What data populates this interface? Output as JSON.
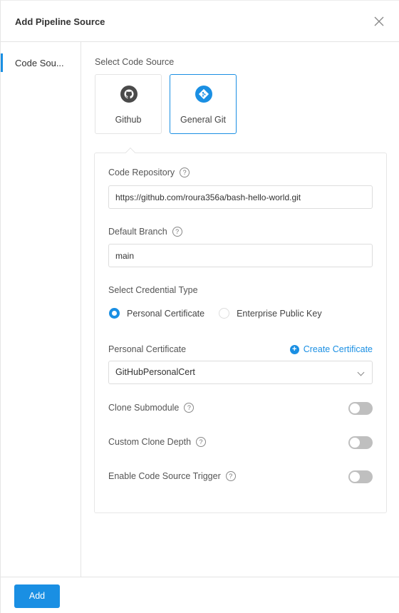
{
  "dialog": {
    "title": "Add Pipeline Source",
    "close_icon": "close-icon"
  },
  "sidebar": {
    "items": [
      {
        "label": "Code Sou...",
        "active": true
      }
    ]
  },
  "code_source": {
    "label": "Select Code Source",
    "options": [
      {
        "label": "Github",
        "icon": "github-icon",
        "selected": false
      },
      {
        "label": "General Git",
        "icon": "git-icon",
        "selected": true
      }
    ]
  },
  "form": {
    "code_repository": {
      "label": "Code Repository",
      "value": "https://github.com/roura356a/bash-hello-world.git"
    },
    "default_branch": {
      "label": "Default Branch",
      "value": "main"
    },
    "credential_type": {
      "label": "Select Credential Type",
      "options": [
        {
          "label": "Personal Certificate",
          "selected": true
        },
        {
          "label": "Enterprise Public Key",
          "selected": false
        }
      ]
    },
    "personal_certificate": {
      "label": "Personal Certificate",
      "create_link": "Create Certificate",
      "selected": "GitHubPersonalCert"
    },
    "toggles": [
      {
        "label": "Clone Submodule",
        "on": false
      },
      {
        "label": "Custom Clone Depth",
        "on": false
      },
      {
        "label": "Enable Code Source Trigger",
        "on": false
      }
    ],
    "help_glyph": "?"
  },
  "footer": {
    "add_label": "Add"
  },
  "colors": {
    "accent": "#1a8fe3",
    "toggle_off": "#bfbfbf",
    "border": "#e4e4e4"
  }
}
